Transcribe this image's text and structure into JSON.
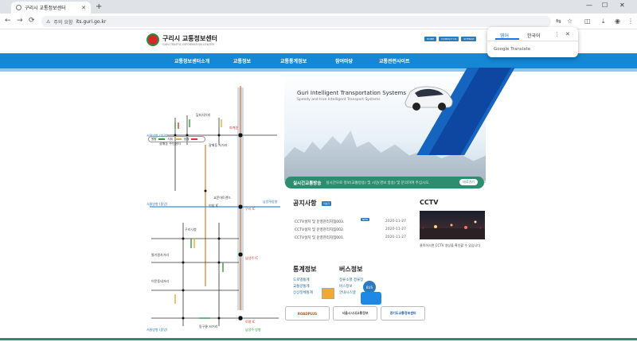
{
  "browser": {
    "tab_title": "구리시 교통정보센터",
    "omnibox_warning": "주의 요함",
    "url": "its.guri.go.kr",
    "translate_popup": {
      "lang_en": "영어",
      "lang_ko": "한국어",
      "brand": "Google Translate"
    }
  },
  "site": {
    "logo_name": "구리시 교통정보센터",
    "logo_sub": "GURI TRAFFIC INFORMATION CENTER",
    "top_links": [
      "HOME",
      "CONTACT US",
      "SITEMAP"
    ],
    "gnb": [
      "교통정보센터소개",
      "교통정보",
      "교통통계정보",
      "참여마당",
      "교통관련사이트"
    ],
    "its_title": "Guri Intelligent Transportation Systems",
    "its_sub": "Speedy and true Intelligent Transport Systems",
    "notice_bar": {
      "title": "실시간교통방송",
      "text": "실시간으로 정보(교통방송) 및 시민(경보 방송) 및 문의하여 주십시오.",
      "more": "바로가기"
    },
    "notice": {
      "title": "공지사항",
      "more": "더보기",
      "rows": [
        {
          "title": "CCTV설치 및 운영관리지침003.",
          "date": "2020-11-27"
        },
        {
          "title": "CCTV설치 및 운영관리지침002.",
          "date": "2020-11-27"
        },
        {
          "title": "CCTV설치 및 운영관리지침001.",
          "date": "2020-11-27"
        }
      ],
      "new_tag": "NEW"
    },
    "cctv": {
      "title": "CCTV",
      "caption": "클릭하시면 CCTV 영상을 확인할 수 있습니다"
    },
    "stats": {
      "title": "통계정보",
      "links": [
        "도로별통계",
        "교통량통계",
        "상상정체통계"
      ]
    },
    "bus": {
      "title": "버스정보",
      "links": [
        "정류소별 정류장",
        "버스정보",
        "안내시스템"
      ],
      "stop_label": "BUS"
    },
    "banners": [
      "ROADPLUS",
      "서울시시내교통정보",
      "경기도교통정보센터"
    ],
    "map": {
      "legend": [
        "원활",
        "지체",
        "정체"
      ],
      "labels_left": [
        "서울방향 (외곽)",
        "서울방향 (중앙)",
        "남양주방향",
        "구리시청",
        "이문동네거리",
        "서울방향 (중앙)"
      ],
      "labels_center": [
        "갈매사거리",
        "담터사거리",
        "구리IC",
        "인창IC",
        "토평IC",
        "남양주IC",
        "안창IC"
      ],
      "colors": {
        "smooth": "#2f9a3e",
        "delay": "#f2a92e",
        "jam": "#d03b2a",
        "road": "#e07a2f",
        "river": "#3a8fd6"
      }
    }
  }
}
